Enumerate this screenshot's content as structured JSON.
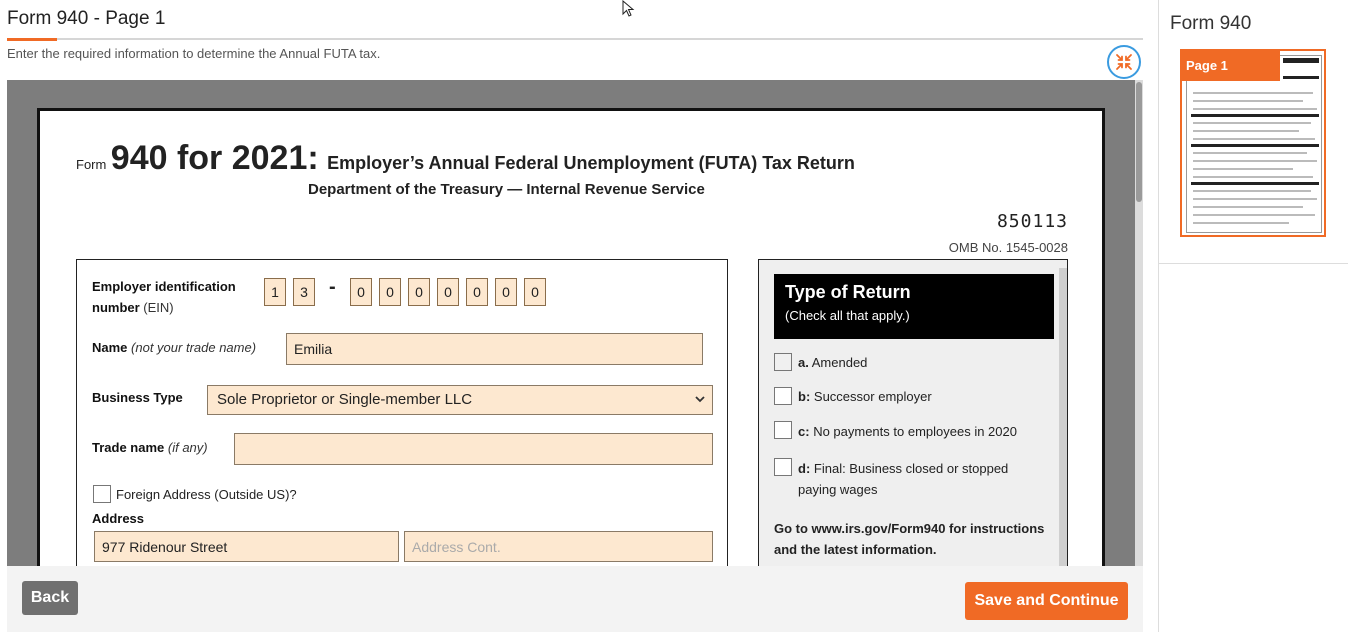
{
  "header": {
    "title": "Form 940 - Page 1",
    "subtitle": "Enter the required information to determine the Annual FUTA tax."
  },
  "icons": {
    "collapse": "collapse-arrows-icon",
    "cursor": "mouse-pointer-icon",
    "select_chevron": "chevron-down-icon"
  },
  "form": {
    "form_word": "Form",
    "form_number": "940 for 2021:",
    "form_name": "Employer’s Annual Federal Unemployment (FUTA) Tax Return",
    "department": "Department of the Treasury — Internal Revenue Service",
    "barcode": "850113",
    "omb": "OMB No. 1545-0028",
    "ein": {
      "label": "Employer identification number",
      "label_suffix": "(EIN)",
      "prefix_digits": [
        "1",
        "3"
      ],
      "dash": "-",
      "suffix_digits": [
        "0",
        "0",
        "0",
        "0",
        "0",
        "0",
        "0"
      ]
    },
    "name": {
      "label": "Name",
      "label_note": "(not your trade name)",
      "value": "Emilia"
    },
    "business_type": {
      "label": "Business Type",
      "value": "Sole Proprietor or Single-member LLC"
    },
    "trade_name": {
      "label": "Trade name",
      "label_note": "(if any)",
      "value": ""
    },
    "foreign_address": {
      "label": "Foreign Address (Outside US)?",
      "checked": false
    },
    "address": {
      "label": "Address",
      "line1": "977 Ridenour Street",
      "line2_placeholder": "Address Cont."
    },
    "type_of_return": {
      "title": "Type of Return",
      "subtitle": "(Check all that apply.)",
      "options": [
        {
          "key": "a.",
          "text": "Amended",
          "checked": false
        },
        {
          "key": "b:",
          "text": "Successor employer",
          "checked": false
        },
        {
          "key": "c:",
          "text": "No payments to employees in 2020",
          "checked": false
        },
        {
          "key": "d:",
          "text": "Final: Business closed or stopped paying wages",
          "checked": false
        }
      ],
      "goto": "Go to www.irs.gov/Form940 for instructions and the latest information."
    }
  },
  "footer": {
    "back_label": "Back",
    "save_label": "Save and Continue"
  },
  "side_panel": {
    "title": "Form 940",
    "thumb_label": "Page 1"
  },
  "colors": {
    "accent": "#f06a25",
    "field_bg": "#fde8d0",
    "collapse_ring": "#3a9be0"
  }
}
